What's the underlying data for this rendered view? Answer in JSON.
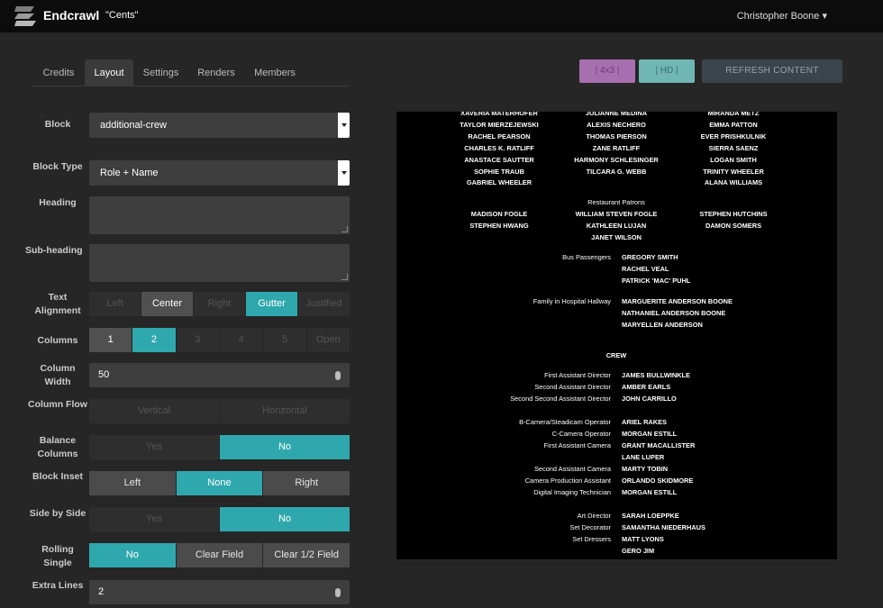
{
  "app": {
    "name": "Endcrawl",
    "project": "\"Cents\"",
    "user": "Christopher Boone ▾"
  },
  "tabs": [
    "Credits",
    "Layout",
    "Settings",
    "Renders",
    "Members"
  ],
  "toolbar": {
    "btn_4x3": "| 4x3 |",
    "btn_hd": "| HD |",
    "refresh": "REFRESH CONTENT"
  },
  "form": {
    "block_label": "Block",
    "block_value": "additional-crew",
    "block_type_label": "Block Type",
    "block_type_value": "Role + Name",
    "heading_label": "Heading",
    "subheading_label": "Sub-heading",
    "text_alignment_label": "Text Alignment",
    "text_alignment_options": [
      "Left",
      "Center",
      "Right",
      "Gutter",
      "Justified"
    ],
    "columns_label": "Columns",
    "columns_options": [
      "1",
      "2",
      "3",
      "4",
      "5",
      "Open"
    ],
    "column_width_label": "Column Width",
    "column_width_value": "50",
    "column_flow_label": "Column Flow",
    "column_flow_options": [
      "Vertical",
      "Horizontal"
    ],
    "balance_columns_label": "Balance Columns",
    "balance_columns_options": [
      "Yes",
      "No"
    ],
    "block_inset_label": "Block Inset",
    "block_inset_options": [
      "Left",
      "None",
      "Right"
    ],
    "side_by_side_label": "Side by Side",
    "side_by_side_options": [
      "Yes",
      "No"
    ],
    "rolling_single_label": "Rolling Single",
    "rolling_single_options": [
      "No",
      "Clear Field",
      "Clear 1/2 Field"
    ],
    "extra_lines_label": "Extra Lines",
    "extra_lines_value": "2"
  },
  "preview": {
    "cast_rows": [
      [
        "XAVERIA MATERHOFER",
        "JULIANNE MEDINA",
        "MIRANDA METZ"
      ],
      [
        "TAYLOR MIERZEJEWSKI",
        "ALEXIS NECHERO",
        "EMMA PATTON"
      ],
      [
        "RACHEL PEARSON",
        "THOMAS PIERSON",
        "EVER PRISHKULNIK"
      ],
      [
        "CHARLES K. RATLIFF",
        "ZANE RATLIFF",
        "SIERRA SAENZ"
      ],
      [
        "ANASTACE SAUTTER",
        "HARMONY SCHLESINGER",
        "LOGAN SMITH"
      ],
      [
        "SOPHIE TRAUB",
        "TILCARA G. WEBB",
        "TRINITY WHEELER"
      ],
      [
        "GABRIEL WHEELER",
        "",
        "ALANA WILLIAMS"
      ]
    ],
    "patrons_heading": "Restaurant Patrons",
    "patrons_rows": [
      [
        "MADISON FOGLE",
        "WILLIAM STEVEN FOGLE",
        "STEPHEN HUTCHINS"
      ],
      [
        "STEPHEN HWANG",
        "KATHLEEN LUJAN",
        "DAMON SOMERS"
      ],
      [
        "",
        "JANET WILSON",
        ""
      ]
    ],
    "crew_heading": "CREW",
    "credits": [
      {
        "role": "Bus Passengers",
        "names": [
          "GREGORY SMITH",
          "RACHEL VEAL",
          "PATRICK 'MAC' PUHL"
        ]
      },
      {
        "role": "Family in Hospital Hallway",
        "names": [
          "MARGUERITE ANDERSON BOONE",
          "NATHANIEL ANDERSON BOONE",
          "MARYELLEN ANDERSON"
        ]
      },
      {
        "role": "First Assistant Director",
        "names": [
          "JAMES BULLWINKLE"
        ]
      },
      {
        "role": "Second Assistant Director",
        "names": [
          "AMBER EARLS"
        ]
      },
      {
        "role": "Second Second Assistant Director",
        "names": [
          "JOHN CARRILLO"
        ]
      },
      {
        "role": "B-Camera/Steadicam Operator",
        "names": [
          "ARIEL RAKES"
        ]
      },
      {
        "role": "C-Camera Operator",
        "names": [
          "MORGAN ESTILL"
        ]
      },
      {
        "role": "First Assistant Camera",
        "names": [
          "GRANT MACALLISTER",
          "LANE LUPER"
        ]
      },
      {
        "role": "Second Assistant Camera",
        "names": [
          "MARTY TOBIN"
        ]
      },
      {
        "role": "Camera Production Assistant",
        "names": [
          "ORLANDO SKIDMORE"
        ]
      },
      {
        "role": "Digital Imaging Technician",
        "names": [
          "MORGAN ESTILL"
        ]
      },
      {
        "role": "Art Director",
        "names": [
          "SARAH LOEPPKE"
        ]
      },
      {
        "role": "Set Decorator",
        "names": [
          "SAMANTHA NIEDERHAUS"
        ]
      },
      {
        "role": "Set Dressers",
        "names": [
          "MATT LYONS",
          "GERO JIM"
        ]
      }
    ]
  }
}
